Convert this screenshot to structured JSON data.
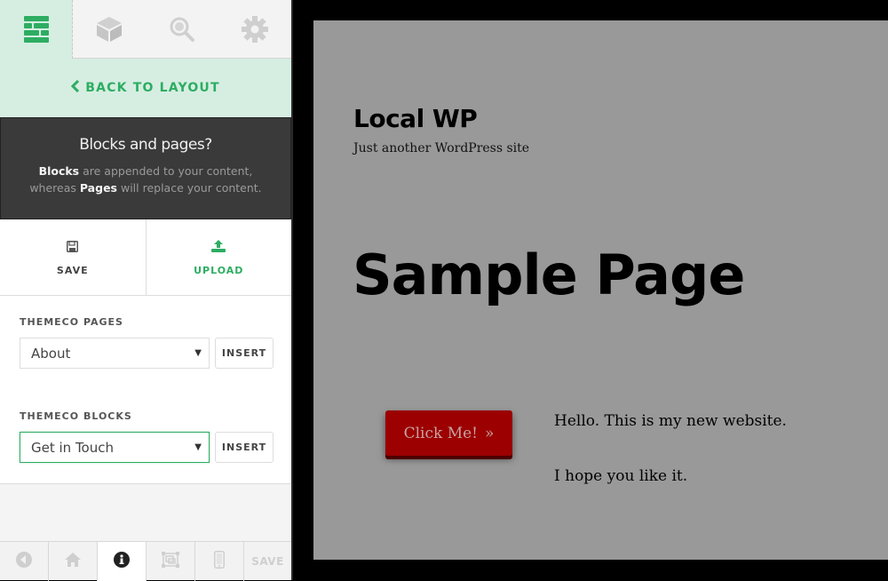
{
  "sidebar": {
    "tabs": [
      {
        "name": "layout",
        "icon": "layout-blocks-icon",
        "active": true
      },
      {
        "name": "elements",
        "icon": "cube-icon",
        "active": false
      },
      {
        "name": "inspector",
        "icon": "magnifier-icon",
        "active": false
      },
      {
        "name": "settings",
        "icon": "gear-icon",
        "active": false
      }
    ],
    "back_link": "BACK TO LAYOUT",
    "info": {
      "title": "Blocks and pages?",
      "line1_bold": "Blocks",
      "line1_rest": " are appended to your content,",
      "line2_pre": "whereas ",
      "line2_bold": "Pages",
      "line2_rest": " will replace your content."
    },
    "actions": {
      "save_label": "SAVE",
      "upload_label": "UPLOAD"
    },
    "pages": {
      "label": "THEMECO PAGES",
      "selected": "About",
      "insert_label": "INSERT"
    },
    "blocks": {
      "label": "THEMECO BLOCKS",
      "selected": "Get in Touch",
      "insert_label": "INSERT"
    },
    "bottom_bar": {
      "items": [
        "collapse",
        "home",
        "info",
        "responsive-preview",
        "mobile"
      ],
      "save_label": "SAVE"
    }
  },
  "preview": {
    "site_title": "Local WP",
    "site_description": "Just another WordPress site",
    "page_title": "Sample Page",
    "button_label": "Click Me!",
    "button_arrow": "»",
    "paragraph_1": "Hello. This is my new website.",
    "paragraph_2": "I hope you like it."
  },
  "colors": {
    "accent": "#2dad62",
    "accent_bg": "#d6eee2",
    "info_bg": "#3a3a3a",
    "preview_bg": "#999999",
    "button_bg": "#9c0000"
  }
}
